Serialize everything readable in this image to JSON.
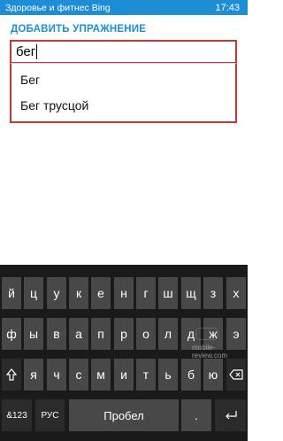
{
  "status_bar": {
    "app_title": "Здоровье и фитнес Bing",
    "time": "17:43",
    "color": "#1d8ed6"
  },
  "page": {
    "heading": "ДОБАВИТЬ УПРАЖНЕНИЕ"
  },
  "search": {
    "value": "бег",
    "border_color": "#c8372d"
  },
  "suggestions": [
    "Бег",
    "Бег трусцой"
  ],
  "keyboard": {
    "row1": [
      "й",
      "ц",
      "у",
      "к",
      "е",
      "н",
      "г",
      "ш",
      "щ",
      "з",
      "х"
    ],
    "row2": [
      "ф",
      "ы",
      "в",
      "а",
      "п",
      "р",
      "о",
      "л",
      "д",
      "ж",
      "э"
    ],
    "row3": [
      "я",
      "ч",
      "с",
      "м",
      "и",
      "т",
      "ь",
      "б",
      "ю"
    ],
    "shift_icon": "shift-arrow-icon",
    "backspace_icon": "backspace-icon",
    "symbols_label": "&123",
    "language_label": "РУС",
    "space_label": "Пробел",
    "period_label": ".",
    "enter_icon": "enter-icon"
  },
  "watermark": {
    "text": "mobile-review.com"
  }
}
